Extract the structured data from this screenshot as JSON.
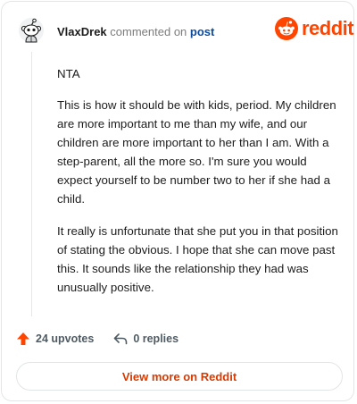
{
  "comment": {
    "username": "VlaxDrek",
    "action": "commented on",
    "target": "post",
    "paragraphs": [
      "NTA",
      "This is how it should be with kids, period. My children are more important to me than my wife, and our children are more important to her than I am. With a step-parent, all the more so. I'm sure you would expect yourself to be number two to her if she had a child.",
      "It really is unfortunate that she put you in that position of stating the obvious. I hope that she can move past this. It sounds like the relationship they had was unusually positive."
    ]
  },
  "brand": {
    "name": "reddit",
    "color": "#ff4500"
  },
  "footer": {
    "upvotes_label": "24 upvotes",
    "replies_label": "0 replies",
    "upvote_icon": "upvote-arrow-icon",
    "reply_icon": "reply-arrow-icon"
  },
  "cta": {
    "label": "View more on Reddit",
    "color": "#d93a00"
  }
}
